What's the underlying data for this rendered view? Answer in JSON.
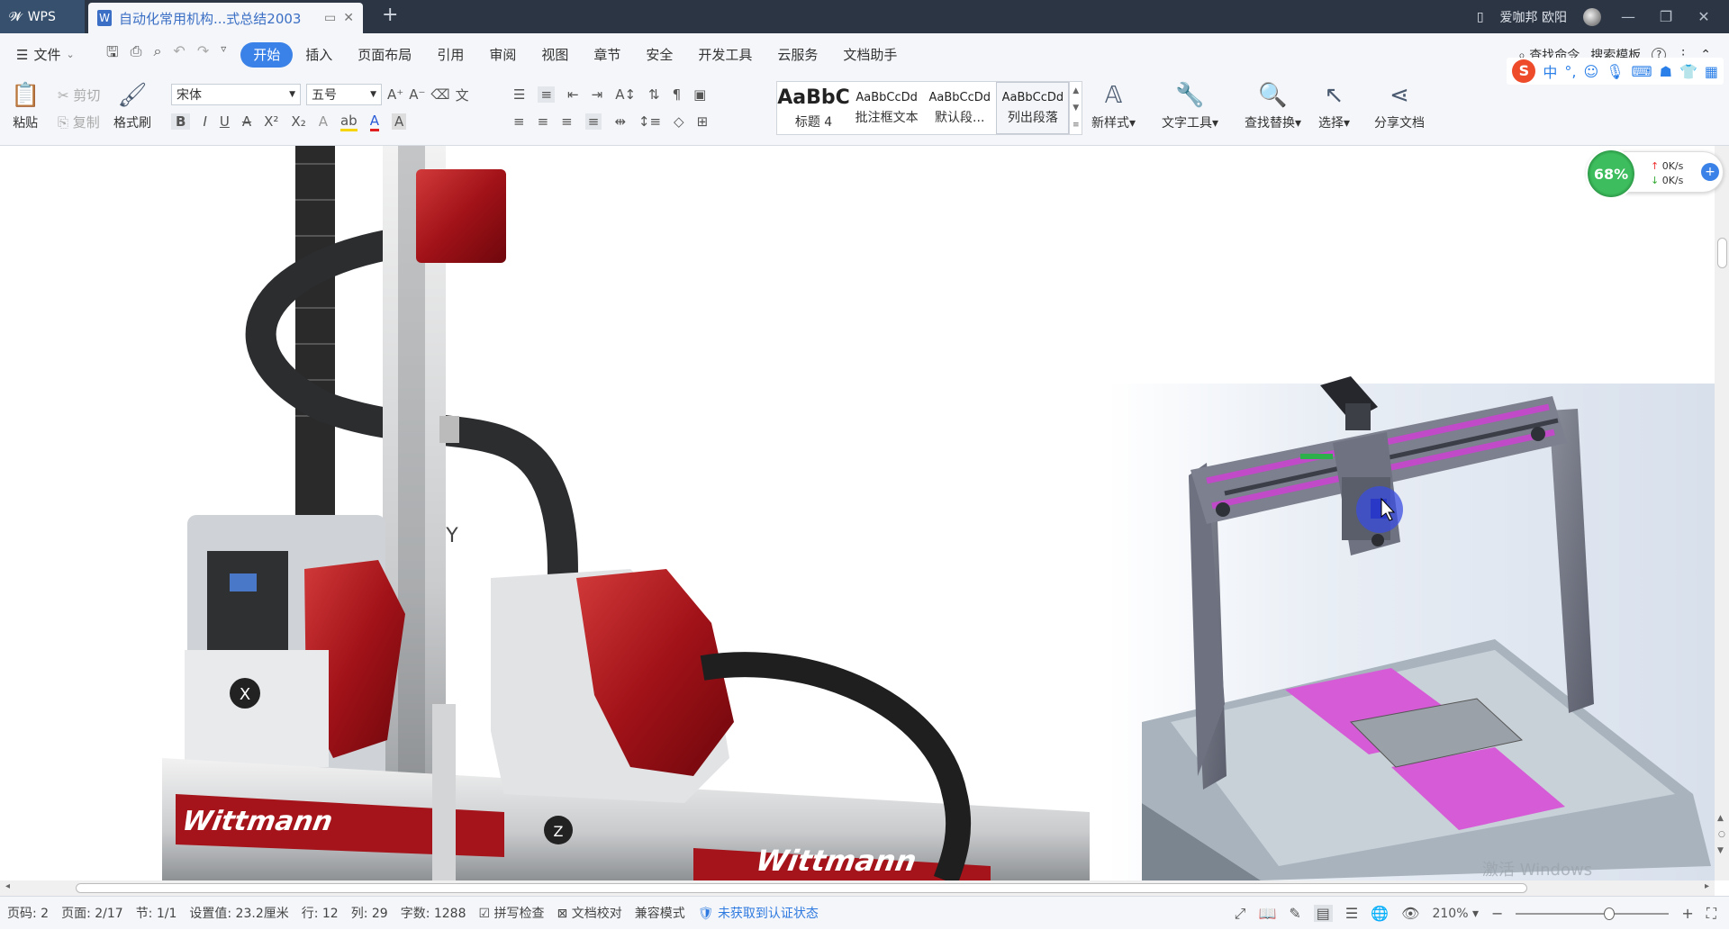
{
  "titlebar": {
    "app_name": "WPS",
    "doc_tab_title": "自动化常用机构...式总结2003",
    "user_name": "爱咖邦 欧阳"
  },
  "menu": {
    "file_label": "文件",
    "tabs": [
      {
        "label": "开始",
        "active": true
      },
      {
        "label": "插入"
      },
      {
        "label": "页面布局"
      },
      {
        "label": "引用"
      },
      {
        "label": "审阅"
      },
      {
        "label": "视图"
      },
      {
        "label": "章节"
      },
      {
        "label": "安全"
      },
      {
        "label": "开发工具"
      },
      {
        "label": "云服务"
      },
      {
        "label": "文档助手"
      }
    ],
    "find_command": "查找命令",
    "search_template": "搜索模板",
    "help": "?"
  },
  "ime": {
    "logo": "S",
    "mode": "中"
  },
  "ribbon": {
    "paste": "粘贴",
    "cut": "剪切",
    "copy": "复制",
    "format_painter": "格式刷",
    "font_name": "宋体",
    "font_size": "五号",
    "styles": [
      {
        "preview": "AaBbC",
        "label": "标题 4"
      },
      {
        "preview": "AaBbCcDd",
        "label": "批注框文本"
      },
      {
        "preview": "AaBbCcDd",
        "label": "默认段..."
      },
      {
        "preview": "AaBbCcDd",
        "label": "列出段落"
      }
    ],
    "new_style": "新样式",
    "text_tools": "文字工具",
    "find_replace": "查找替换",
    "select": "选择",
    "share_doc": "分享文档"
  },
  "network_monitor": {
    "percent": "68%",
    "upload": "0K/s",
    "download": "0K/s"
  },
  "document": {
    "left_robot_brand": "Wittmann",
    "x_axis_badge": "X",
    "y_axis_badge": "Y",
    "z_axis_badge": "Z",
    "watermark": "激活 Windows"
  },
  "statusbar": {
    "page_code": "页码: 2",
    "page": "页面: 2/17",
    "section": "节: 1/1",
    "setting": "设置值: 23.2厘米",
    "row": "行: 12",
    "col": "列: 29",
    "word_count": "字数: 1288",
    "spell_check": "拼写检查",
    "doc_proof": "文档校对",
    "compat_mode": "兼容模式",
    "auth_status": "未获取到认证状态",
    "zoom": "210%",
    "zoom_fraction": 0.62
  },
  "colors": {
    "accent": "#3b82e8",
    "titlebar": "#2b3544",
    "ribbon_bg": "#f4f6f9"
  }
}
